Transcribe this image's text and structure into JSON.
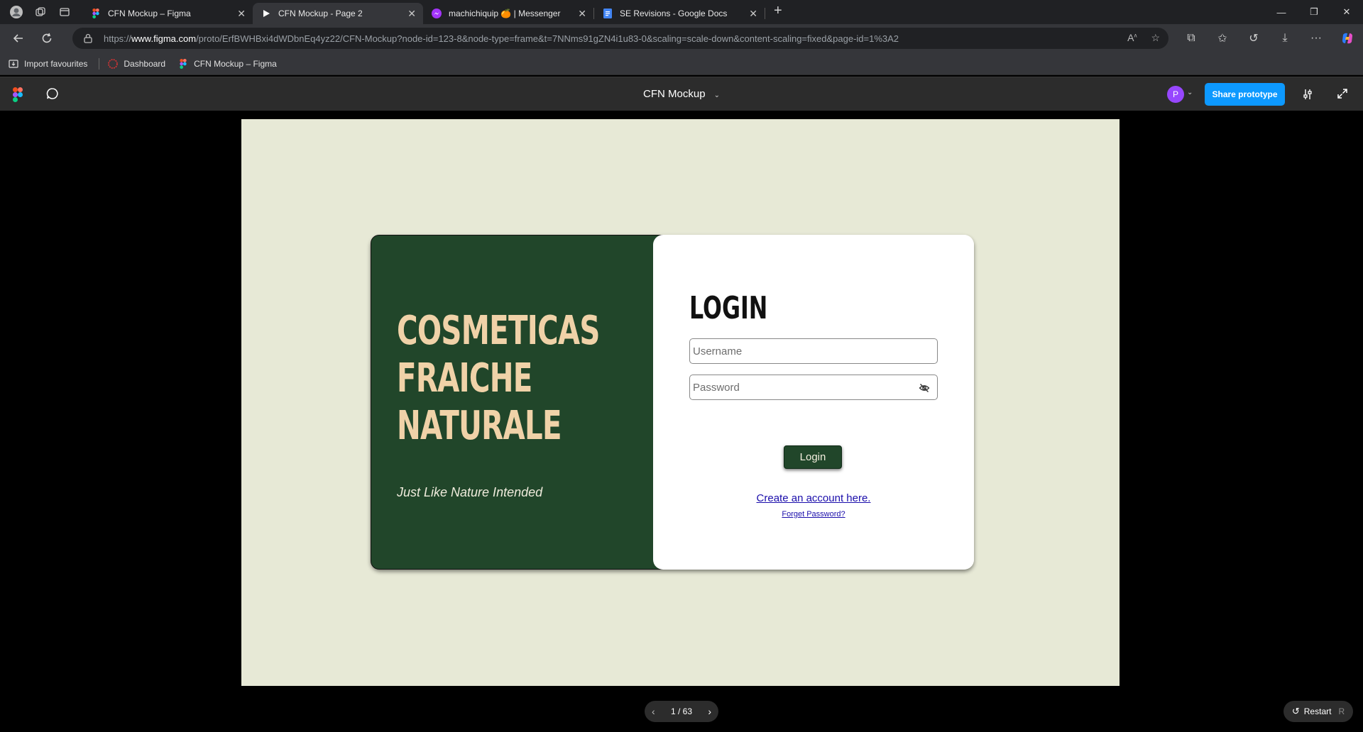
{
  "browser": {
    "tabs": [
      {
        "title": "CFN Mockup – Figma",
        "icon": "figma-icon",
        "active": false
      },
      {
        "title": "CFN Mockup - Page 2",
        "icon": "play-icon",
        "active": true
      },
      {
        "title": "machichiquip 🍊 | Messenger",
        "icon": "messenger-icon",
        "active": false
      },
      {
        "title": "SE Revisions - Google Docs",
        "icon": "google-docs-icon",
        "active": false
      }
    ],
    "url_prefix": "https://",
    "url_domain": "www.figma.com",
    "url_path": "/proto/ErfBWHBxi4dWDbnEq4yz22/CFN-Mockup?node-id=123-8&node-type=frame&t=7NNms91gZN4i1u83-0&scaling=scale-down&content-scaling=fixed&page-id=1%3A2",
    "bookmarks": [
      {
        "label": "Import favourites",
        "icon": "import-icon"
      },
      {
        "label": "Dashboard",
        "icon": "dashboard-icon"
      },
      {
        "label": "CFN Mockup – Figma",
        "icon": "figma-icon"
      }
    ]
  },
  "figma": {
    "file_title": "CFN Mockup",
    "avatar_initial": "P",
    "share_label": "Share prototype",
    "page_indicator": "1 / 63",
    "restart_label": "Restart",
    "restart_shortcut": "R",
    "colors": {
      "share_button": "#0d99ff",
      "avatar": "#9747ff",
      "frame_bg": "#e7e9d6"
    }
  },
  "login_card": {
    "brand_lines": [
      "COSMETICAS",
      "FRAICHE",
      "NATURALE"
    ],
    "tagline": "Just Like Nature Intended",
    "title": "LOGIN",
    "username_placeholder": "Username",
    "password_placeholder": "Password",
    "login_button": "Login",
    "create_account_link": "Create an account here.",
    "forgot_password_link": "Forget Password?",
    "colors": {
      "brand_green": "#21462a",
      "brand_cream": "#f0d2a8",
      "link": "#1a0dab"
    }
  }
}
